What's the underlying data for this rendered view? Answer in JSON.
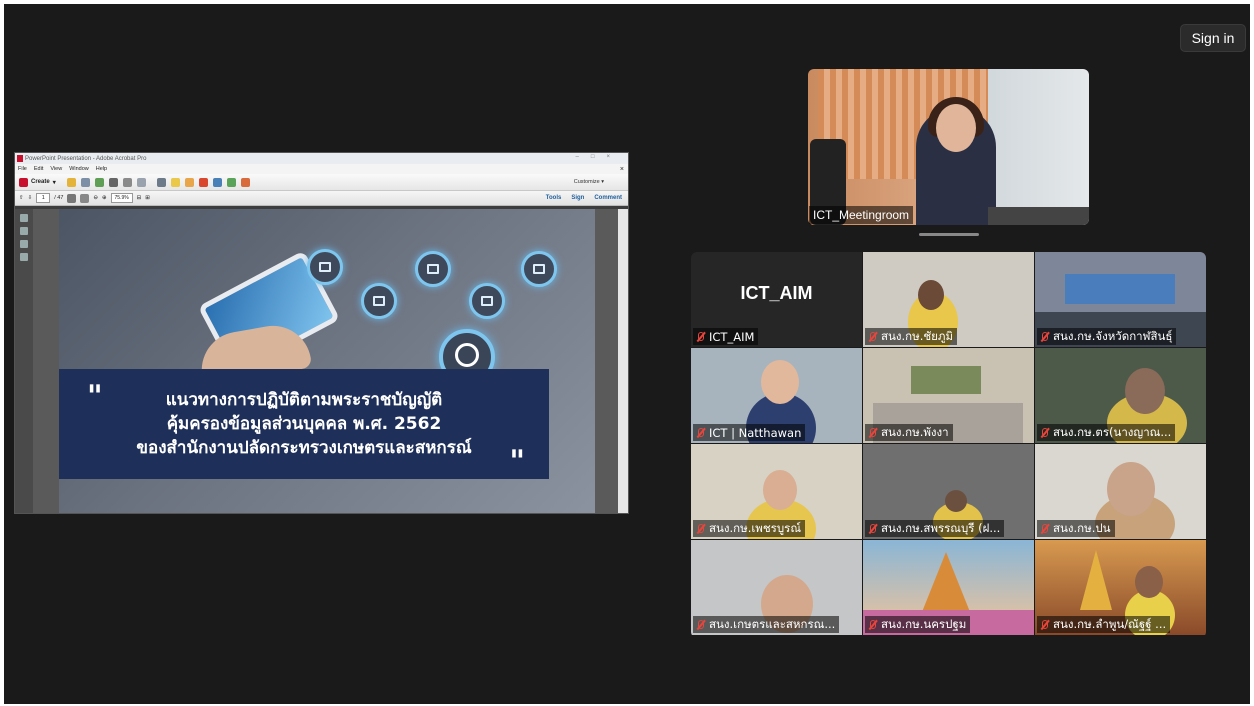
{
  "header": {
    "sign_in": "Sign in"
  },
  "shared_screen": {
    "window_title": "PowerPoint Presentation - Adobe Acrobat Pro",
    "menu": [
      "File",
      "Edit",
      "View",
      "Window",
      "Help"
    ],
    "toolbar": {
      "create": "Create",
      "customize": "Customize"
    },
    "nav": {
      "page": "1",
      "total": "/ 47",
      "zoom": "75.9%"
    },
    "links": {
      "tools": "Tools",
      "sign": "Sign",
      "comment": "Comment"
    },
    "slide": {
      "line1": "แนวทางการปฏิบัติตามพระราชบัญญัติ",
      "line2": "คุ้มครองข้อมูลส่วนบุคคล พ.ศ. 2562",
      "line3": "ของสำนักงานปลัดกระทรวงเกษตรและสหกรณ์"
    }
  },
  "speaker": {
    "name": "ICT_Meetingroom"
  },
  "participants": [
    {
      "name": "ICT_AIM",
      "big_label": "ICT_AIM",
      "color": "#262626"
    },
    {
      "name": "สนง.กษ.ชัยภูมิ",
      "color": "#cfcac2"
    },
    {
      "name": "สนง.กษ.จังหวัดกาฬสินธุ์",
      "color": "#7d8799"
    },
    {
      "name": "ICT | Natthawan",
      "color": "#a7b3bd"
    },
    {
      "name": "สนง.กษ.พังงา",
      "color": "#c9c2b3"
    },
    {
      "name": "สนง.กษ.ตร(นางญาณ...",
      "color": "#4d5a4a"
    },
    {
      "name": "สนง.กษ.เพชรบูรณ์",
      "color": "#d7d2c4"
    },
    {
      "name": "สนง.กษ.สพรรณบุรี (ฝ...",
      "color": "#6f6f6f"
    },
    {
      "name": "สนง.กษ.ปน",
      "color": "#dad7d0"
    },
    {
      "name": "สนง.เกษตรและสหกรณ...",
      "color": "#c5c6c8"
    },
    {
      "name": "สนง.กษ.นครปฐม",
      "color": "#8ab6d6"
    },
    {
      "name": "สนง.กษ.ลำพูน/ณัฐฐ์ ...",
      "color": "#b06a3a"
    }
  ]
}
